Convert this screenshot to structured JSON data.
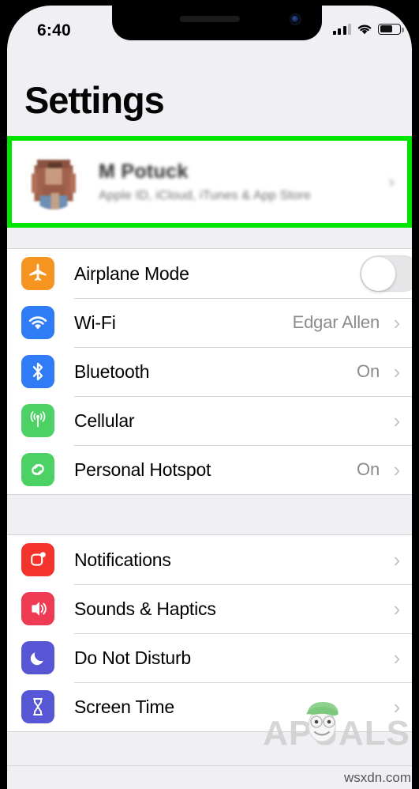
{
  "status_bar": {
    "time": "6:40",
    "signal_icon": "cellular-bars-icon",
    "wifi_icon": "wifi-icon",
    "battery_icon": "battery-icon",
    "battery_level_pct": 58
  },
  "header": {
    "title": "Settings"
  },
  "account": {
    "name": "M Potuck",
    "subtitle": "Apple ID, iCloud, iTunes & App Store",
    "avatar_icon": "profile-photo-avatar",
    "chevron": "›",
    "highlighted": true,
    "highlight_color": "#00e500"
  },
  "groups": [
    {
      "rows": [
        {
          "label": "Airplane Mode",
          "icon": "airplane-icon",
          "icon_color": "#F69422",
          "accessory": "toggle",
          "toggle_on": false,
          "value": ""
        },
        {
          "label": "Wi-Fi",
          "icon": "wifi-icon",
          "icon_color": "#2F7CF6",
          "accessory": "chevron",
          "value": "Edgar Allen",
          "chevron": "›"
        },
        {
          "label": "Bluetooth",
          "icon": "bluetooth-icon",
          "icon_color": "#2F7CF6",
          "accessory": "chevron",
          "value": "On",
          "chevron": "›"
        },
        {
          "label": "Cellular",
          "icon": "cellular-antenna-icon",
          "icon_color": "#4CD264",
          "accessory": "chevron",
          "value": "",
          "chevron": "›"
        },
        {
          "label": "Personal Hotspot",
          "icon": "personal-hotspot-icon",
          "icon_color": "#4CD264",
          "accessory": "chevron",
          "value": "On",
          "chevron": "›"
        }
      ]
    },
    {
      "rows": [
        {
          "label": "Notifications",
          "icon": "notifications-icon",
          "icon_color": "#F4332C",
          "accessory": "chevron",
          "value": "",
          "chevron": "›"
        },
        {
          "label": "Sounds & Haptics",
          "icon": "sounds-haptics-icon",
          "icon_color": "#EE3A52",
          "accessory": "chevron",
          "value": "",
          "chevron": "›"
        },
        {
          "label": "Do Not Disturb",
          "icon": "do-not-disturb-moon-icon",
          "icon_color": "#5756D5",
          "accessory": "chevron",
          "value": "",
          "chevron": "›"
        },
        {
          "label": "Screen Time",
          "icon": "screen-time-hourglass-icon",
          "icon_color": "#5756D5",
          "accessory": "chevron",
          "value": "",
          "chevron": "›"
        }
      ]
    }
  ],
  "watermark": {
    "brand_a": "A",
    "brand_rest": "PUALS",
    "face_icon": "appuals-mascot-icon"
  },
  "footer": {
    "url": "wsxdn.com"
  }
}
